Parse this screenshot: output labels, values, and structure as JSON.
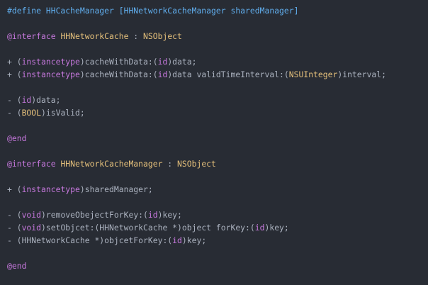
{
  "editor": {
    "language": "Objective-C",
    "colors": {
      "background": "#282c34",
      "plain": "#abb2bf",
      "keyword": "#c678dd",
      "class": "#e5c07b",
      "macro": "#61afef"
    },
    "lines": [
      [
        {
          "t": "#define HHCacheManager [HHNetworkCacheManager sharedManager]",
          "c": "macro"
        }
      ],
      [],
      [
        {
          "t": "@interface",
          "c": "keyword"
        },
        {
          "t": " ",
          "c": "plain"
        },
        {
          "t": "HHNetworkCache",
          "c": "classname"
        },
        {
          "t": " : ",
          "c": "plain"
        },
        {
          "t": "NSObject",
          "c": "classname"
        }
      ],
      [],
      [
        {
          "t": "+ (",
          "c": "plain"
        },
        {
          "t": "instancetype",
          "c": "type"
        },
        {
          "t": ")cacheWithData:(",
          "c": "plain"
        },
        {
          "t": "id",
          "c": "type"
        },
        {
          "t": ")data;",
          "c": "plain"
        }
      ],
      [
        {
          "t": "+ (",
          "c": "plain"
        },
        {
          "t": "instancetype",
          "c": "type"
        },
        {
          "t": ")cacheWithData:(",
          "c": "plain"
        },
        {
          "t": "id",
          "c": "type"
        },
        {
          "t": ")data validTimeInterval:(",
          "c": "plain"
        },
        {
          "t": "NSUInteger",
          "c": "classname"
        },
        {
          "t": ")interval;",
          "c": "plain"
        }
      ],
      [],
      [
        {
          "t": "- (",
          "c": "plain"
        },
        {
          "t": "id",
          "c": "type"
        },
        {
          "t": ")data;",
          "c": "plain"
        }
      ],
      [
        {
          "t": "- (",
          "c": "plain"
        },
        {
          "t": "BOOL",
          "c": "classname"
        },
        {
          "t": ")isValid;",
          "c": "plain"
        }
      ],
      [],
      [
        {
          "t": "@end",
          "c": "keyword"
        }
      ],
      [],
      [
        {
          "t": "@interface",
          "c": "keyword"
        },
        {
          "t": " ",
          "c": "plain"
        },
        {
          "t": "HHNetworkCacheManager",
          "c": "classname"
        },
        {
          "t": " : ",
          "c": "plain"
        },
        {
          "t": "NSObject",
          "c": "classname"
        }
      ],
      [],
      [
        {
          "t": "+ (",
          "c": "plain"
        },
        {
          "t": "instancetype",
          "c": "type"
        },
        {
          "t": ")sharedManager;",
          "c": "plain"
        }
      ],
      [],
      [
        {
          "t": "- (",
          "c": "plain"
        },
        {
          "t": "void",
          "c": "type"
        },
        {
          "t": ")removeObejectForKey:(",
          "c": "plain"
        },
        {
          "t": "id",
          "c": "type"
        },
        {
          "t": ")key;",
          "c": "plain"
        }
      ],
      [
        {
          "t": "- (",
          "c": "plain"
        },
        {
          "t": "void",
          "c": "type"
        },
        {
          "t": ")setObjcet:(HHNetworkCache *)object forKey:(",
          "c": "plain"
        },
        {
          "t": "id",
          "c": "type"
        },
        {
          "t": ")key;",
          "c": "plain"
        }
      ],
      [
        {
          "t": "- (HHNetworkCache *)objcetForKey:(",
          "c": "plain"
        },
        {
          "t": "id",
          "c": "type"
        },
        {
          "t": ")key;",
          "c": "plain"
        }
      ],
      [],
      [
        {
          "t": "@end",
          "c": "keyword"
        }
      ]
    ]
  }
}
